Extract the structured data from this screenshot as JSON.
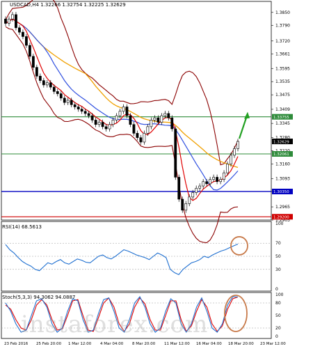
{
  "header": {
    "symbol_line": "USDCAD,H4",
    "ohlc": "1.32266 1.32754 1.32225 1.32629"
  },
  "rsi_label": "RSI(14) 68.5613",
  "stoch_label": "Stoch(5,3,3) 94.3062 94.0887",
  "watermark": "instaforex.com",
  "colors": {
    "candle": "#000000",
    "bollinger": "#8b0000",
    "ma_fast": "#e00000",
    "ma_slow": "#3050e0",
    "ma_long": "#f0a000",
    "level_green": "#2e8b3a",
    "level_blue": "#0000c0",
    "level_red": "#d00000",
    "rsi_line": "#1e6fd0",
    "stoch_main": "#1e6fd0",
    "stoch_signal": "#e00000",
    "circle": "#c87a4a",
    "arrow": "#22a022"
  },
  "chart_data": [
    {
      "type": "candlestick",
      "title": "",
      "ylim": [
        1.2905,
        1.39
      ],
      "y_ticks": [
        "1.3850",
        "1.3790",
        "1.3720",
        "1.3661",
        "1.3595",
        "1.3535",
        "1.3475",
        "1.3409",
        "1.3345",
        "1.3280",
        "1.3220",
        "1.3160",
        "1.3093",
        "1.3035",
        "1.2965",
        "1.2905"
      ],
      "x_labels": [
        "23 Feb 2016",
        "25 Feb 20:00",
        "1 Mar 12:00",
        "4 Mar 04:00",
        "8 Mar 20:00",
        "11 Mar 12:00",
        "16 Mar 04:00",
        "18 Mar 20:00",
        "23 Mar 12:00"
      ],
      "close": [
        1.38,
        1.382,
        1.384,
        1.378,
        1.376,
        1.374,
        1.37,
        1.365,
        1.36,
        1.356,
        1.354,
        1.352,
        1.353,
        1.351,
        1.349,
        1.348,
        1.346,
        1.344,
        1.345,
        1.343,
        1.342,
        1.341,
        1.34,
        1.339,
        1.338,
        1.336,
        1.334,
        1.335,
        1.333,
        1.332,
        1.334,
        1.336,
        1.338,
        1.34,
        1.342,
        1.338,
        1.334,
        1.33,
        1.328,
        1.326,
        1.33,
        1.333,
        1.336,
        1.337,
        1.335,
        1.338,
        1.339,
        1.337,
        1.332,
        1.31,
        1.3,
        1.295,
        1.298,
        1.301,
        1.303,
        1.305,
        1.306,
        1.308,
        1.307,
        1.309,
        1.31,
        1.308,
        1.309,
        1.312,
        1.316,
        1.32,
        1.323,
        1.3263
      ],
      "levels": [
        {
          "value": 1.3375,
          "label": "1.33755",
          "color": "green"
        },
        {
          "value": 1.3206,
          "label": "1.32061",
          "color": "green"
        },
        {
          "value": 1.3035,
          "label": "1.30350",
          "color": "blue"
        },
        {
          "value": 1.292,
          "label": "1.29200",
          "color": "red"
        }
      ],
      "current_price_label": "1.32629",
      "current_price": 1.32629
    },
    {
      "type": "line",
      "title": "RSI(14) 68.5613",
      "ylim": [
        0,
        100
      ],
      "y_ticks": [
        "100",
        "70",
        "50",
        "30",
        "0"
      ],
      "values": [
        68,
        60,
        55,
        48,
        42,
        38,
        35,
        30,
        28,
        34,
        40,
        38,
        42,
        45,
        40,
        38,
        42,
        46,
        44,
        41,
        40,
        45,
        50,
        52,
        48,
        46,
        50,
        55,
        60,
        58,
        55,
        52,
        50,
        48,
        45,
        50,
        55,
        52,
        48,
        30,
        25,
        22,
        30,
        35,
        40,
        42,
        45,
        50,
        48,
        52,
        55,
        58,
        60,
        63,
        66,
        68.6
      ]
    },
    {
      "type": "line",
      "title": "Stoch(5,3,3) 94.3062 94.0887",
      "ylim": [
        0,
        100
      ],
      "y_ticks": [
        "100",
        "80",
        "50",
        "20",
        "0"
      ],
      "main": [
        80,
        60,
        30,
        10,
        15,
        50,
        85,
        90,
        70,
        30,
        10,
        20,
        60,
        90,
        85,
        40,
        10,
        15,
        55,
        88,
        92,
        60,
        20,
        10,
        40,
        80,
        95,
        70,
        30,
        10,
        20,
        60,
        90,
        80,
        30,
        10,
        30,
        70,
        92,
        60,
        20,
        10,
        30,
        75,
        95,
        94.3
      ],
      "signal": [
        75,
        65,
        40,
        20,
        15,
        40,
        75,
        88,
        75,
        40,
        15,
        18,
        50,
        85,
        88,
        50,
        15,
        12,
        45,
        80,
        92,
        70,
        30,
        12,
        30,
        70,
        92,
        78,
        40,
        15,
        15,
        50,
        85,
        85,
        40,
        12,
        25,
        60,
        88,
        70,
        30,
        12,
        25,
        65,
        90,
        94.1
      ]
    }
  ]
}
